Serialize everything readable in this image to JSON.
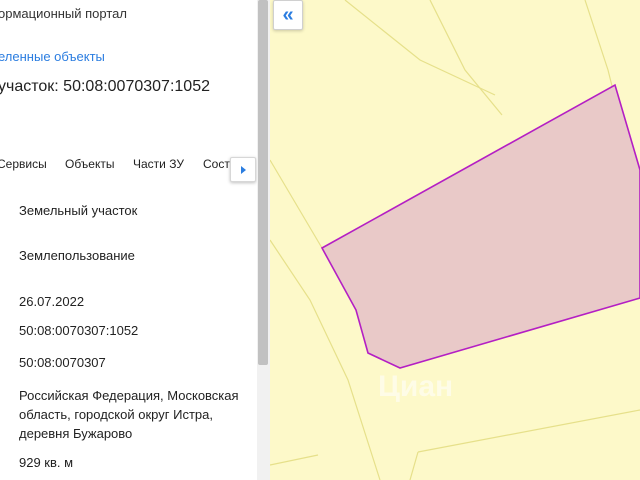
{
  "header": {
    "portal_title": "ормационный портал",
    "selected_objects_link": "еленные объекты",
    "parcel_heading": "участок: 50:08:0070307:1052"
  },
  "tabs": [
    {
      "label": "Сервисы"
    },
    {
      "label": "Объекты"
    },
    {
      "label": "Части ЗУ"
    },
    {
      "label": "Соста"
    }
  ],
  "properties": {
    "object_type": "Земельный участок",
    "land_use": "Землепользование",
    "date": "26.07.2022",
    "cadastral_number": "50:08:0070307:1052",
    "quarter_number": "50:08:0070307",
    "address": "Российская Федерация, Московская область, городской округ Истра, деревня Бужарово",
    "area": "929 кв. м"
  },
  "map": {
    "collapse_icon": "«",
    "watermark": "Циан",
    "colors": {
      "background": "#fdf9c9",
      "parcel_fill": "#e9c9c8",
      "parcel_stroke": "#b41fc4",
      "lines": "#e6e08a"
    }
  }
}
